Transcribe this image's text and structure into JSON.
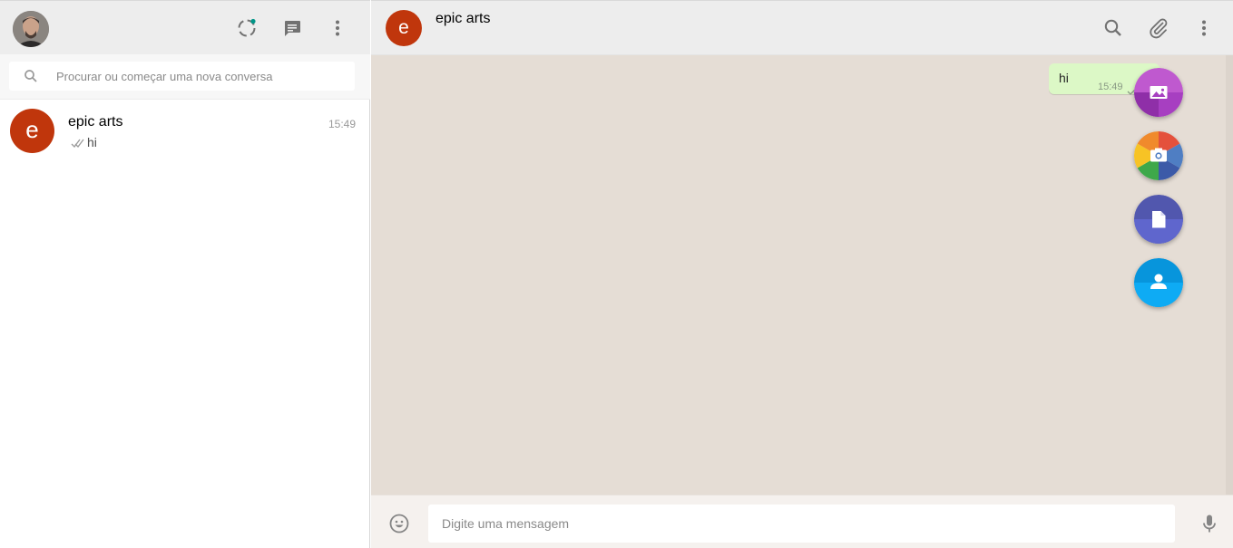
{
  "sidebar": {
    "header": {
      "avatar": "profile-photo",
      "icons": [
        "status-icon",
        "new-chat-icon",
        "menu-icon"
      ],
      "status_dot_color": "#009688"
    },
    "search": {
      "placeholder": "Procurar ou começar uma nova conversa",
      "value": ""
    },
    "chats": [
      {
        "initial": "e",
        "name": "epic arts",
        "time": "15:49",
        "last_message": "hi",
        "avatar_color": "#c0360c"
      }
    ]
  },
  "conversation": {
    "header": {
      "initial": "e",
      "name": "epic arts",
      "icons": [
        "search-icon",
        "attach-icon",
        "menu-icon"
      ]
    },
    "background": "#e5ddd5",
    "messages": [
      {
        "direction": "out",
        "text": "hi",
        "time": "15:49",
        "bubble_color": "#dcf8c6"
      }
    ],
    "attach_menu": [
      {
        "name": "photos-videos",
        "icon": "image-icon",
        "color": "#ac44cf"
      },
      {
        "name": "camera",
        "icon": "camera-icon",
        "color": "multicolor"
      },
      {
        "name": "document",
        "icon": "document-icon",
        "color": "#5157ae"
      },
      {
        "name": "contact",
        "icon": "contact-icon",
        "color": "#0795dc"
      }
    ]
  },
  "composer": {
    "placeholder": "Digite uma mensagem",
    "value": ""
  }
}
